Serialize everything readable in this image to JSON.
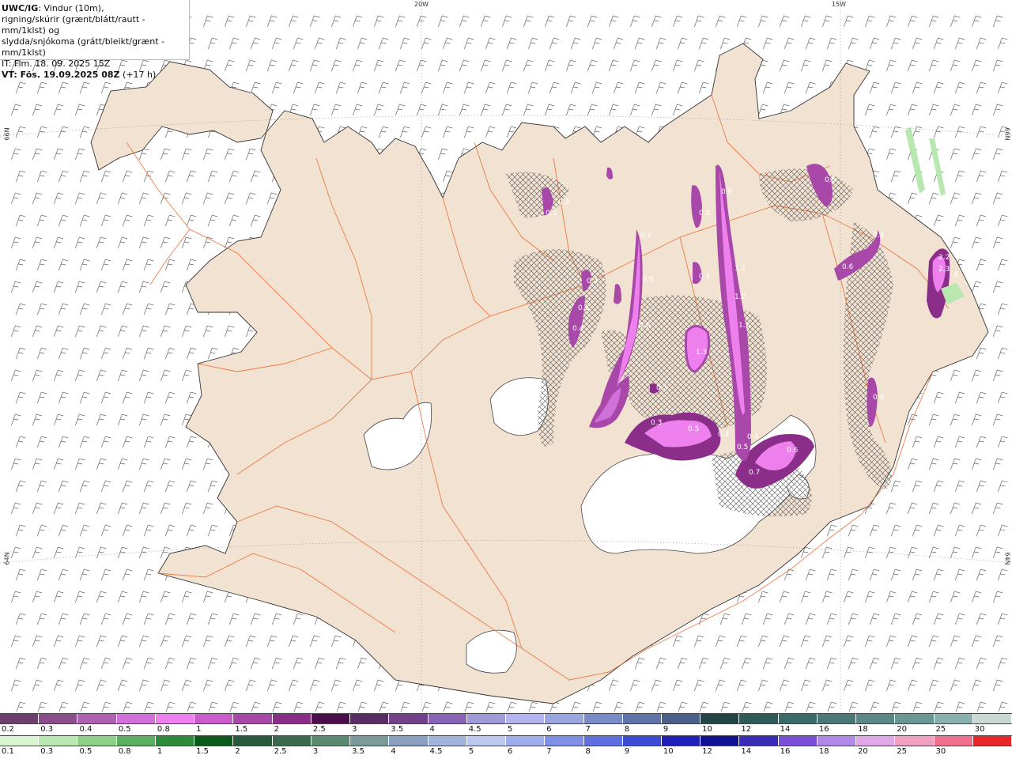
{
  "title": {
    "model": "UWC/IG",
    "line1_rest": ": Vindur (10m),",
    "line2": "rigning/skúrir (grænt/blátt/rautt - mm/1klst) og",
    "line3": "slydda/snjókoma (grátt/bleikt/grænt - mm/1klst)",
    "it": "IT: Fim. 18. 09. 2025 15Z",
    "vt_bold": "VT: Fös. 19.09.2025 08Z",
    "vt_rest": " (+17 h)"
  },
  "graticule": {
    "lon_20w": "20W",
    "lon_15w": "15W",
    "lat_66n_left": "66N",
    "lat_66n_right": "66N",
    "lat_64n_left": "64N",
    "lat_64n_right": "64N"
  },
  "precip_labels": [
    "0.6",
    "0.3",
    "0.3",
    "0.4",
    "0.5",
    "0.4",
    "0.2",
    "1.2",
    "1.2",
    "1.2",
    "1.3",
    "0.6",
    "0.4",
    "0.4",
    "0.5",
    "0.6",
    "0.5",
    "0.6",
    "0.5",
    "0.5",
    "0.4",
    "0.4",
    "0.3",
    "0.6",
    "2.2",
    "2.3",
    "6",
    "0.4",
    "0.5",
    "0.7"
  ],
  "legend_snow": {
    "colors": [
      "#6d3f6d",
      "#8a4f8a",
      "#b060b0",
      "#d070d8",
      "#ee80ee",
      "#cc5ccc",
      "#a848a8",
      "#8a2e8a",
      "#4a0f4a",
      "#5a2c66",
      "#73408a",
      "#8a64b4",
      "#a09ad8",
      "#b4b4ee",
      "#9aa6e0",
      "#7a8cc8",
      "#6074aa",
      "#4a6088",
      "#224444",
      "#2f5a5a",
      "#3a6a6a",
      "#4a7878",
      "#5a8888",
      "#6a9696",
      "#8ab0b0",
      "#c8d8d4"
    ],
    "ticks": [
      "0.2",
      "0.3",
      "0.4",
      "0.5",
      "0.8",
      "1",
      "1.5",
      "2",
      "2.5",
      "3",
      "3.5",
      "4",
      "4.5",
      "5",
      "6",
      "7",
      "8",
      "9",
      "10",
      "12",
      "14",
      "16",
      "18",
      "20",
      "25",
      "30"
    ]
  },
  "legend_rain": {
    "colors": [
      "#d8f4d0",
      "#b8e8b0",
      "#8ed08a",
      "#5ab060",
      "#2c8a38",
      "#0a5a1c",
      "#285a3a",
      "#3a6a4e",
      "#5a8a70",
      "#7a9a9a",
      "#8aa0c0",
      "#a2b4dc",
      "#bcc8f0",
      "#a0aef0",
      "#8090e8",
      "#6070e0",
      "#3c4ad4",
      "#2020b8",
      "#101090",
      "#3a2ab8",
      "#7a50d8",
      "#b088e8",
      "#e0a8e8",
      "#f0a0c0",
      "#f07090",
      "#e82828"
    ],
    "ticks": [
      "0.1",
      "0.3",
      "0.5",
      "0.8",
      "1",
      "1.5",
      "2",
      "2.5",
      "3",
      "3.5",
      "4",
      "4.5",
      "5",
      "6",
      "7",
      "8",
      "9",
      "10",
      "12",
      "14",
      "16",
      "18",
      "20",
      "25",
      "30"
    ]
  }
}
